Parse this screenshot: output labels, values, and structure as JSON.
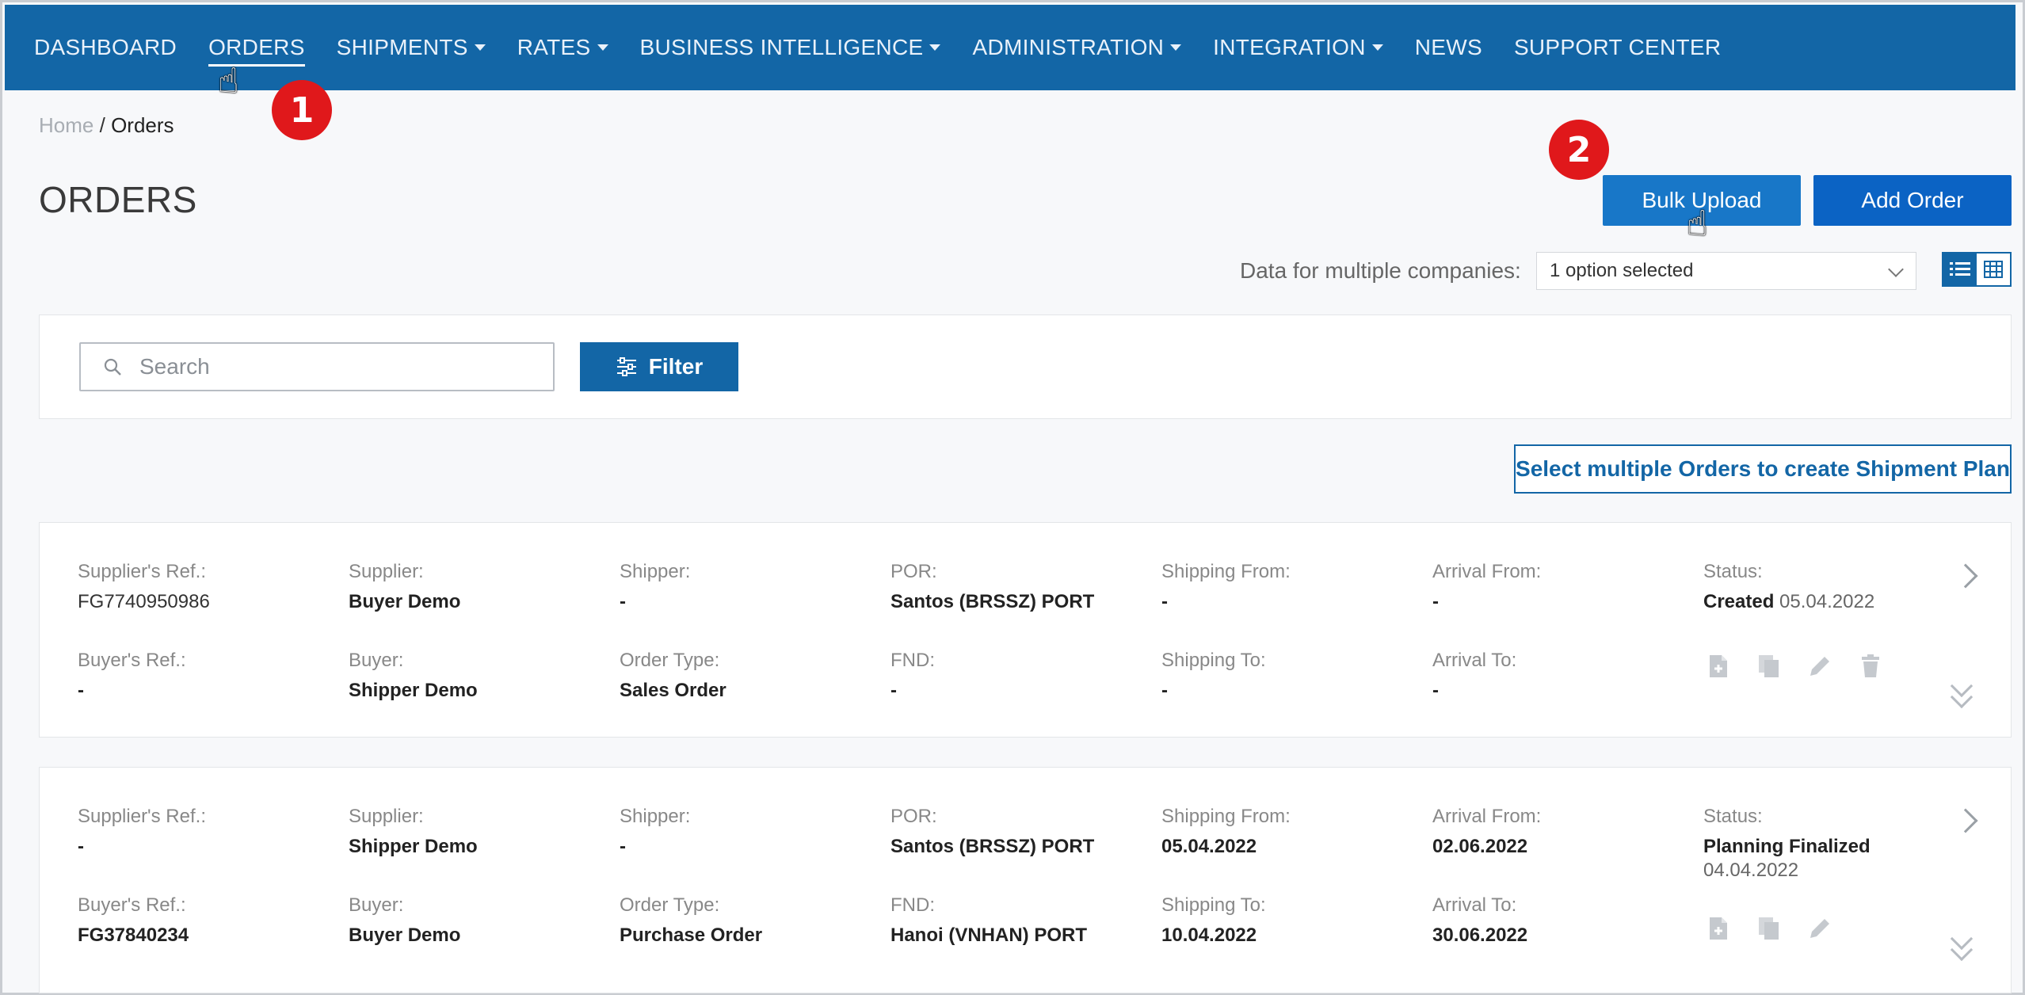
{
  "nav": {
    "items": [
      {
        "label": "DASHBOARD",
        "dropdown": false,
        "active": false
      },
      {
        "label": "ORDERS",
        "dropdown": false,
        "active": true
      },
      {
        "label": "SHIPMENTS",
        "dropdown": true,
        "active": false
      },
      {
        "label": "RATES",
        "dropdown": true,
        "active": false
      },
      {
        "label": "BUSINESS INTELLIGENCE",
        "dropdown": true,
        "active": false
      },
      {
        "label": "ADMINISTRATION",
        "dropdown": true,
        "active": false
      },
      {
        "label": "INTEGRATION",
        "dropdown": true,
        "active": false
      },
      {
        "label": "NEWS",
        "dropdown": false,
        "active": false
      },
      {
        "label": "SUPPORT CENTER",
        "dropdown": false,
        "active": false
      }
    ],
    "bg_color": "#1366a6"
  },
  "steps": {
    "one": "1",
    "two": "2"
  },
  "breadcrumb": {
    "home": "Home",
    "separator": "/",
    "current": "Orders"
  },
  "page": {
    "title": "ORDERS"
  },
  "actions": {
    "bulk_upload": "Bulk Upload",
    "add_order": "Add Order"
  },
  "companies": {
    "label": "Data for multiple companies:",
    "selected": "1 option selected"
  },
  "search": {
    "placeholder": "Search",
    "filter_label": "Filter"
  },
  "shipment_plan_button": "Select multiple Orders to create Shipment Plan",
  "orders": [
    {
      "suppliers_ref_label": "Supplier's Ref.:",
      "suppliers_ref": "FG7740950986",
      "supplier_label": "Supplier:",
      "supplier": "Buyer Demo",
      "shipper_label": "Shipper:",
      "shipper": "-",
      "por_label": "POR:",
      "por": "Santos (BRSSZ) PORT",
      "shipping_from_label": "Shipping From:",
      "shipping_from": "-",
      "arrival_from_label": "Arrival From:",
      "arrival_from": "-",
      "status_label": "Status:",
      "status": "Created",
      "status_date": "05.04.2022",
      "buyers_ref_label": "Buyer's Ref.:",
      "buyers_ref": "-",
      "buyer_label": "Buyer:",
      "buyer": "Shipper Demo",
      "order_type_label": "Order Type:",
      "order_type": "Sales Order",
      "fnd_label": "FND:",
      "fnd": "-",
      "shipping_to_label": "Shipping To:",
      "shipping_to": "-",
      "arrival_to_label": "Arrival To:",
      "arrival_to": "-"
    },
    {
      "suppliers_ref_label": "Supplier's Ref.:",
      "suppliers_ref": "-",
      "supplier_label": "Supplier:",
      "supplier": "Shipper Demo",
      "shipper_label": "Shipper:",
      "shipper": "-",
      "por_label": "POR:",
      "por": "Santos (BRSSZ) PORT",
      "shipping_from_label": "Shipping From:",
      "shipping_from": "05.04.2022",
      "arrival_from_label": "Arrival From:",
      "arrival_from": "02.06.2022",
      "status_label": "Status:",
      "status": "Planning Finalized",
      "status_date": "04.04.2022",
      "buyers_ref_label": "Buyer's Ref.:",
      "buyers_ref": "FG37840234",
      "buyer_label": "Buyer:",
      "buyer": "Buyer Demo",
      "order_type_label": "Order Type:",
      "order_type": "Purchase Order",
      "fnd_label": "FND:",
      "fnd": "Hanoi (VNHAN) PORT",
      "shipping_to_label": "Shipping To:",
      "shipping_to": "10.04.2022",
      "arrival_to_label": "Arrival To:",
      "arrival_to": "30.06.2022"
    }
  ],
  "icons": [
    "pointer-cursor-icon",
    "search-icon",
    "filter-sliders-icon",
    "list-view-icon",
    "grid-view-icon",
    "chevron-right-icon",
    "double-chevron-down-icon",
    "add-document-icon",
    "copy-icon",
    "edit-pencil-icon",
    "delete-trash-icon"
  ]
}
